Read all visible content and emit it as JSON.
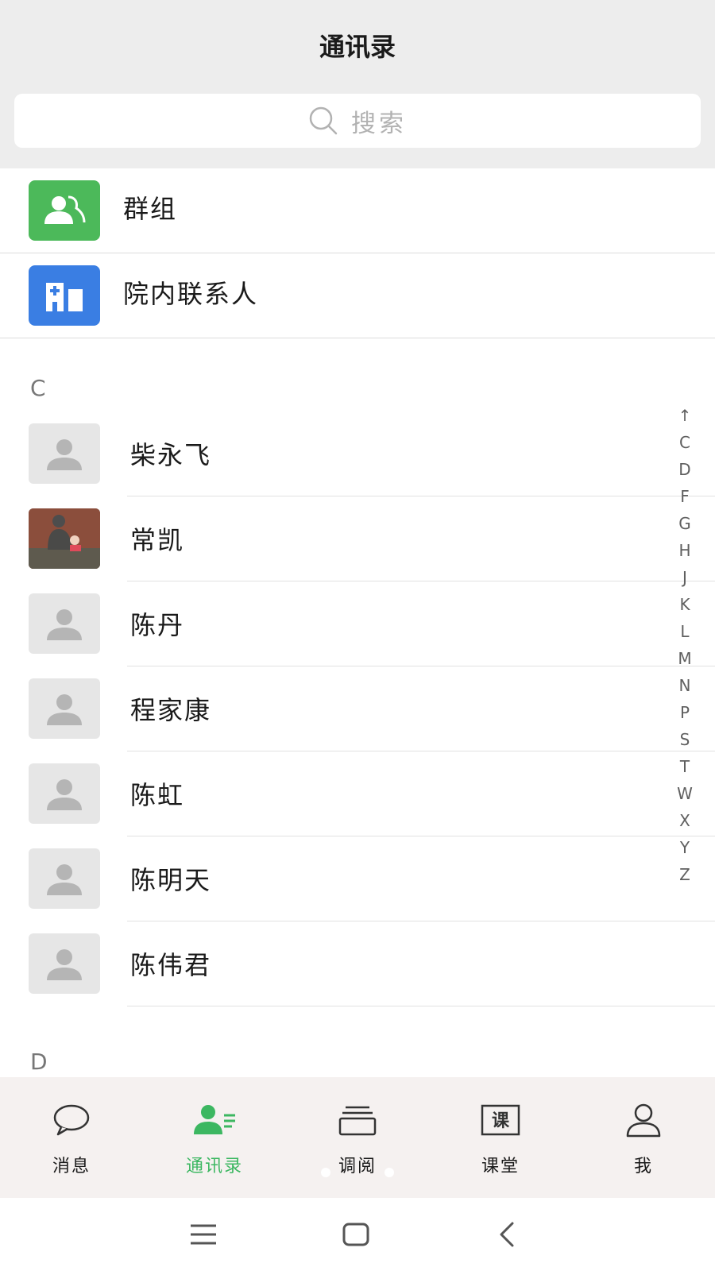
{
  "header": {
    "title": "通讯录",
    "search_placeholder": "搜索"
  },
  "fixed_entries": [
    {
      "label": "群组",
      "icon": "group-icon",
      "color": "#4cb95a"
    },
    {
      "label": "院内联系人",
      "icon": "hospital-icon",
      "color": "#3a7ee3"
    }
  ],
  "sections": [
    {
      "letter": "C",
      "contacts": [
        {
          "name": "柴永飞",
          "avatar": "default"
        },
        {
          "name": "常凯",
          "avatar": "photo"
        },
        {
          "name": "陈丹",
          "avatar": "default"
        },
        {
          "name": "程家康",
          "avatar": "default"
        },
        {
          "name": "陈虹",
          "avatar": "default"
        },
        {
          "name": "陈明天",
          "avatar": "default"
        },
        {
          "name": "陈伟君",
          "avatar": "default"
        }
      ]
    },
    {
      "letter": "D",
      "contacts": []
    }
  ],
  "index_bar": [
    "↑",
    "C",
    "D",
    "F",
    "G",
    "H",
    "J",
    "K",
    "L",
    "M",
    "N",
    "P",
    "S",
    "T",
    "W",
    "X",
    "Y",
    "Z"
  ],
  "tabbar": {
    "active": "通讯录",
    "active_color": "#3cb761",
    "tabs": [
      {
        "label": "消息",
        "icon": "chat-bubble-icon"
      },
      {
        "label": "通讯录",
        "icon": "contacts-icon"
      },
      {
        "label": "调阅",
        "icon": "stack-icon"
      },
      {
        "label": "课堂",
        "icon": "classroom-icon",
        "icon_text": "课"
      },
      {
        "label": "我",
        "icon": "person-icon"
      }
    ]
  },
  "system_nav": [
    {
      "name": "menu-icon"
    },
    {
      "name": "home-icon"
    },
    {
      "name": "back-icon"
    }
  ]
}
